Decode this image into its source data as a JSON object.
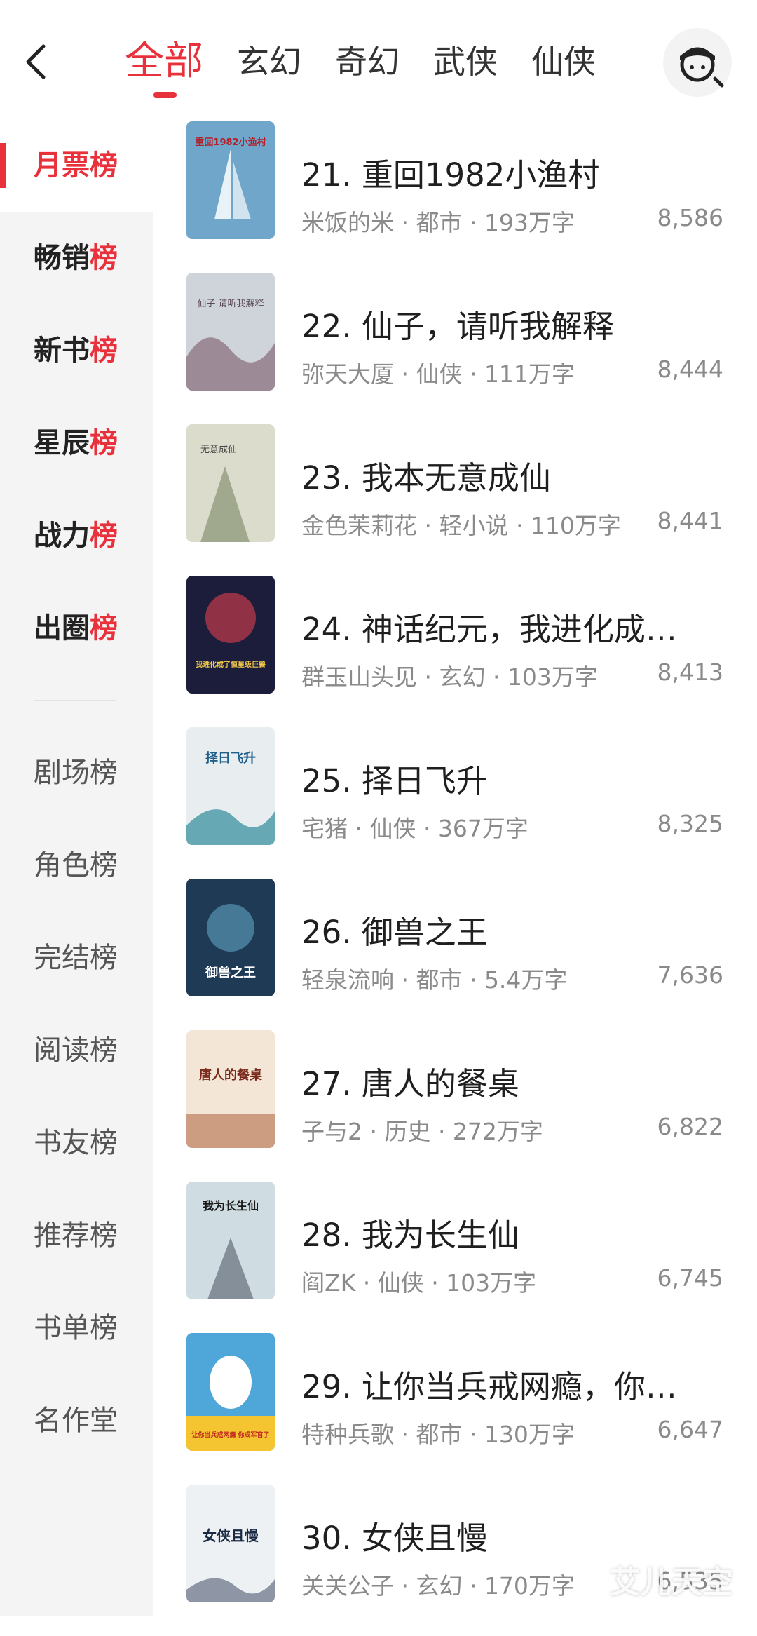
{
  "header": {
    "tabs": [
      "全部",
      "玄幻",
      "奇幻",
      "武侠",
      "仙侠"
    ],
    "active_tab": "全部"
  },
  "sidebar": {
    "items": [
      {
        "main": "月票",
        "suffix": "榜"
      },
      {
        "main": "畅销",
        "suffix": "榜"
      },
      {
        "main": "新书",
        "suffix": "榜"
      },
      {
        "main": "星辰",
        "suffix": "榜"
      },
      {
        "main": "战力",
        "suffix": "榜"
      },
      {
        "main": "出圈",
        "suffix": "榜"
      }
    ],
    "plain_items": [
      "剧场榜",
      "角色榜",
      "完结榜",
      "阅读榜",
      "书友榜",
      "推荐榜",
      "书单榜",
      "名作堂"
    ]
  },
  "books": [
    {
      "title": "21. 重回1982小渔村",
      "meta": "米饭的米 · 都市 · 193万字",
      "count": "8,586",
      "cover_text": "重回1982小渔村",
      "cover_bg": "#6fa6c9",
      "cover_accent": "#e9f2f7"
    },
    {
      "title": "22. 仙子，请听我解释",
      "meta": "弥天大厦 · 仙侠 · 111万字",
      "count": "8,444",
      "cover_text": "仙子 请听我解释",
      "cover_bg": "#cfd3da",
      "cover_accent": "#7a5a6a"
    },
    {
      "title": "23. 我本无意成仙",
      "meta": "金色茉莉花 · 轻小说 · 110万字",
      "count": "8,441",
      "cover_text": "无意成仙",
      "cover_bg": "#dcdccd",
      "cover_accent": "#6f7f5a"
    },
    {
      "title": "24. 神话纪元，我进化成…",
      "meta": "群玉山头见 · 玄幻 · 103万字",
      "count": "8,413",
      "cover_text": "我进化成了恒星级巨兽",
      "cover_bg": "#1b1d3a",
      "cover_accent": "#c23a4a"
    },
    {
      "title": "25. 择日飞升",
      "meta": "宅猪 · 仙侠 · 367万字",
      "count": "8,325",
      "cover_text": "择日飞升",
      "cover_bg": "#e8eef0",
      "cover_accent": "#2f8a9a"
    },
    {
      "title": "26. 御兽之王",
      "meta": "轻泉流响 · 都市 · 5.4万字",
      "count": "7,636",
      "cover_text": "御兽之王",
      "cover_bg": "#1e3a55",
      "cover_accent": "#6bb8d8"
    },
    {
      "title": "27. 唐人的餐桌",
      "meta": "子与2 · 历史 · 272万字",
      "count": "6,822",
      "cover_text": "唐人的餐桌",
      "cover_bg": "#f3e6d6",
      "cover_accent": "#a8542e"
    },
    {
      "title": "28. 我为长生仙",
      "meta": "阎ZK · 仙侠 · 103万字",
      "count": "6,745",
      "cover_text": "我为长生仙",
      "cover_bg": "#cfdde3",
      "cover_accent": "#2b3140"
    },
    {
      "title": "29. 让你当兵戒网瘾，你…",
      "meta": "特种兵歌 · 都市 · 130万字",
      "count": "6,647",
      "cover_text": "让你当兵戒网瘾 你成军官了",
      "cover_bg": "#4fa6d8",
      "cover_accent": "#f4c531"
    },
    {
      "title": "30. 女侠且慢",
      "meta": "关关公子 · 玄幻 · 170万字",
      "count": "6,535",
      "cover_text": "女侠且慢",
      "cover_bg": "#eef1f4",
      "cover_accent": "#2d3a55"
    }
  ],
  "watermark": "艾儿天空"
}
